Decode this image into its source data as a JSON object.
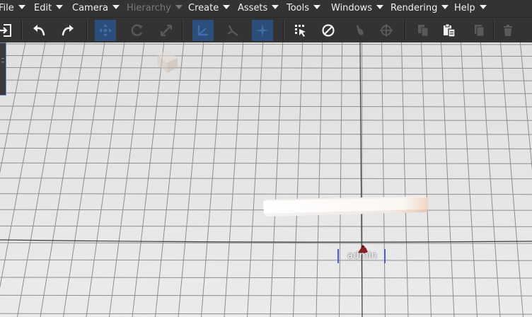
{
  "menu": {
    "file": "File",
    "edit": "Edit",
    "camera": "Camera",
    "hierarchy": "Hierarchy",
    "create": "Create",
    "assets": "Assets",
    "tools": "Tools",
    "windows": "Windows",
    "rendering": "Rendering",
    "help": "Help"
  },
  "toolbar": {
    "icons": [
      "logout-icon",
      "undo-icon",
      "redo-icon",
      "move-icon",
      "rotate-icon",
      "scale-icon",
      "local-space-icon",
      "pivot-icon",
      "snap-icon",
      "select-region-icon",
      "prohibit-icon",
      "cursor-hand-icon",
      "crosshair-icon",
      "copy-icon",
      "paste-icon",
      "duplicate-icon",
      "delete-icon"
    ],
    "active_color": "#2b4f7a"
  },
  "scene": {
    "player_name": "admin",
    "grid_background": "#e3e3e3",
    "grid_line_color": "#8e8e8e",
    "bracket_color": "#4b5bd6"
  }
}
